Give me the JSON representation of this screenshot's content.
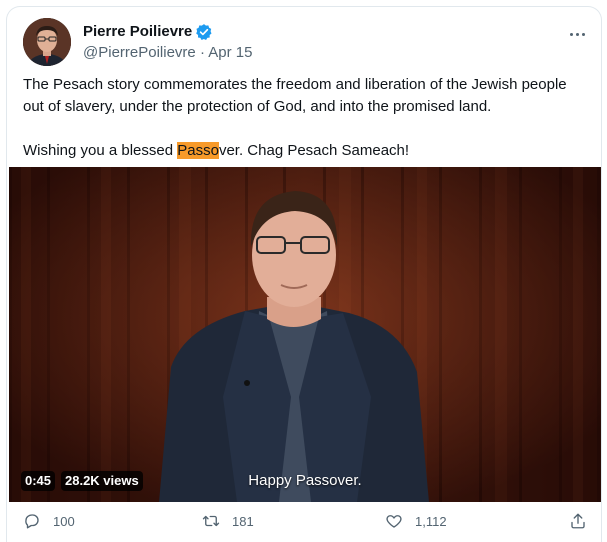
{
  "author": {
    "display_name": "Pierre Poilievre",
    "handle": "@PierrePoilievre",
    "separator": "·",
    "date": "Apr 15"
  },
  "tweet": {
    "line1": "The Pesach story commemorates the freedom and liberation of the Jewish people out of slavery, under the protection of God, and into the promised land.",
    "line2_before": "Wishing you a blessed ",
    "line2_highlight": "Passo",
    "line2_after": "ver. Chag Pesach Sameach!"
  },
  "video": {
    "duration": "0:45",
    "views": "28.2K views",
    "caption": "Happy Passover."
  },
  "actions": {
    "replies": "100",
    "retweets": "181",
    "likes": "1,112"
  },
  "colors": {
    "text": "#0f1419",
    "secondary": "#536471",
    "verified": "#1d9bf0",
    "highlight": "#f79a2a",
    "border": "#e1e8ed"
  },
  "icons": {
    "verified": "verified-badge-icon",
    "more": "more-icon",
    "reply": "reply-icon",
    "retweet": "retweet-icon",
    "like": "heart-icon",
    "share": "share-icon"
  }
}
